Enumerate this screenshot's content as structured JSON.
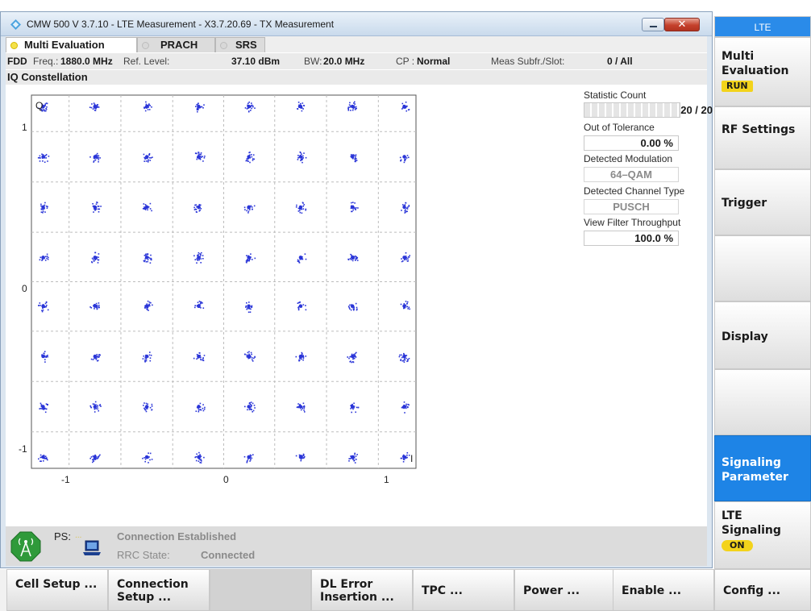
{
  "window": {
    "title": "CMW 500 V 3.7.10 - LTE Measurement  - X3.7.20.69 - TX Measurement",
    "minimize_icon": "minimize-icon",
    "close_icon": "close-icon",
    "close_glyph": "✕"
  },
  "tabs": [
    {
      "label": "Multi Evaluation",
      "active": true
    },
    {
      "label": "PRACH",
      "active": false
    },
    {
      "label": "SRS",
      "active": false
    }
  ],
  "info": {
    "mode": "FDD",
    "freq_label": "Freq.:",
    "freq_value": "1880.0 MHz",
    "ref_label": "Ref. Level:",
    "ref_value": "37.10 dBm",
    "bw_label": "BW:",
    "bw_value": "20.0 MHz",
    "cp_label": "CP :",
    "cp_value": "Normal",
    "meas_label": "Meas Subfr./Slot:",
    "meas_value": "0  / All"
  },
  "section_title": "IQ Constellation",
  "plot": {
    "y_axis_label": "Q",
    "x_axis_label": "I",
    "y_ticks": [
      "1",
      "0",
      "-1"
    ],
    "x_ticks": [
      "-1",
      "0",
      "1"
    ],
    "point_color": "#2a35d8"
  },
  "chart_data": {
    "type": "scatter",
    "title": "IQ Constellation",
    "xlabel": "I",
    "ylabel": "Q",
    "modulation": "64-QAM",
    "grid": true,
    "xlim": [
      -1.15,
      1.15
    ],
    "ylim": [
      -1.15,
      1.15
    ],
    "x_levels": [
      -1.08,
      -0.77,
      -0.46,
      -0.15,
      0.15,
      0.46,
      0.77,
      1.08
    ],
    "y_levels": [
      1.08,
      0.77,
      0.46,
      0.15,
      -0.15,
      -0.46,
      -0.77,
      -1.08
    ]
  },
  "stats": {
    "statistic_count_label": "Statistic Count",
    "statistic_count_value": "20 / 20",
    "statistic_count_fraction": 1.0,
    "out_of_tolerance_label": "Out of Tolerance",
    "out_of_tolerance_value": "0.00  %",
    "detected_modulation_label": "Detected Modulation",
    "detected_modulation_value": "64–QAM",
    "detected_channel_label": "Detected Channel Type",
    "detected_channel_value": "PUSCH",
    "view_filter_label": "View Filter Throughput",
    "view_filter_value": "100.0  %"
  },
  "status": {
    "ps_label": "PS:",
    "connection_text": "Connection Established",
    "rrc_label": "RRC State:",
    "rrc_value": "Connected",
    "antenna_icon": "antenna-icon",
    "laptop_icon": "laptop-icon"
  },
  "right_keys": {
    "header": "LTE",
    "multi_eval": "Multi Evaluation",
    "multi_eval_status": "RUN",
    "rf_settings": "RF Settings",
    "trigger": "Trigger",
    "display": "Display",
    "signaling_parameter": "Signaling Parameter",
    "lte_signaling": "LTE Signaling",
    "lte_signaling_status": "ON"
  },
  "bottom_keys": [
    "Cell Setup ...",
    "Connection Setup ...",
    "",
    "DL Error Insertion ...",
    "TPC ...",
    "Power ...",
    "Enable ...",
    "Config ..."
  ]
}
